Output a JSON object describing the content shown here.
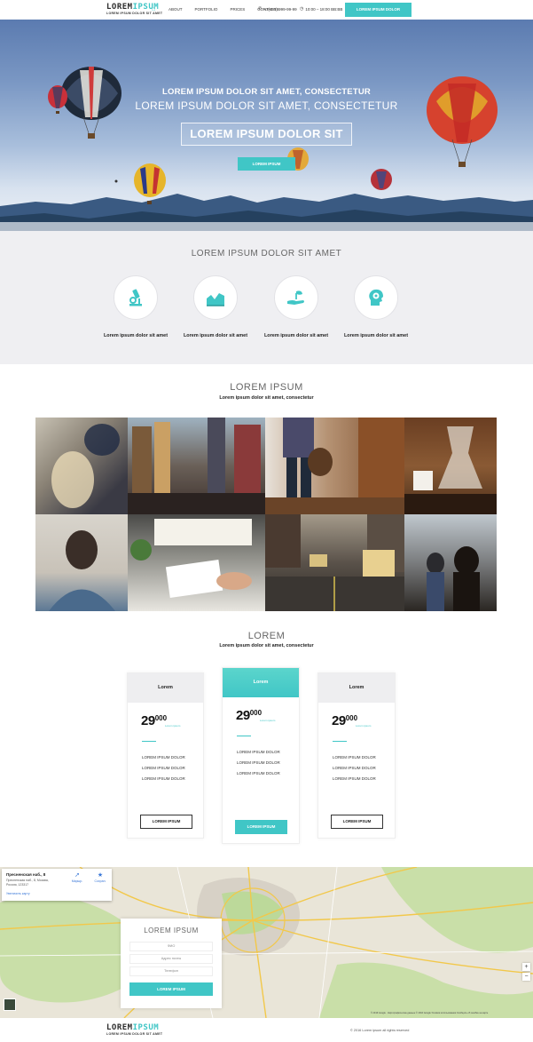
{
  "colors": {
    "accent": "#40c6c6",
    "dark": "#2b2b2b"
  },
  "header": {
    "logo_part1": "LOREM",
    "logo_part2": "IPSUM",
    "logo_sub": "LOREM IPSUM DOLOR SIT AMET",
    "nav": [
      "ABOUT",
      "PORTFOLIO",
      "PRICES",
      "CONTACTS"
    ],
    "phone": "+7(495) 999-99-99",
    "hours": "10:00 – 18:00 ВВ:ВВ",
    "button": "LOREM IPSUM DOLOR"
  },
  "hero": {
    "title1": "LOREM IPSUM DOLOR SIT AMET, CONSECTETUR",
    "title2": "LOREM IPSUM DOLOR SIT AMET, CONSECTETUR",
    "box_text": "LOREM IPSUM DOLOR SIT",
    "button": "LOREM IPSUM"
  },
  "features": {
    "title": "LOREM IPSUM DOLOR SIT AMET",
    "items": [
      {
        "icon": "microscope-icon",
        "label": "Lorem ipsum dolor sit amet"
      },
      {
        "icon": "chart-icon",
        "label": "Lorem ipsum dolor sit amet"
      },
      {
        "icon": "plant-hand-icon",
        "label": "Lorem ipsum dolor sit amet"
      },
      {
        "icon": "head-gear-icon",
        "label": "Lorem ipsum dolor sit amet"
      }
    ]
  },
  "gallery": {
    "title": "LOREM IPSUM",
    "subtitle": "Lorem ipsum dolor sit amet, consectetur"
  },
  "pricing": {
    "title": "LOREM",
    "subtitle": "Lorem ipsum dolor sit amet, consectetur",
    "cards": [
      {
        "name": "Lorem",
        "price": "29",
        "price_sup": "000",
        "note": "Lorem ipsum",
        "items": [
          "LOREM IPSUM DOLOR",
          "LOREM IPSUM DOLOR",
          "LOREM IPSUM DOLOR"
        ],
        "button": "LOREM IPSUM"
      },
      {
        "name": "Lorem",
        "price": "29",
        "price_sup": "000",
        "note": "Lorem ipsum",
        "items": [
          "LOREM IPSUM DOLOR",
          "LOREM IPSUM DOLOR",
          "LOREM IPSUM DOLOR"
        ],
        "button": "LOREM IPSUM"
      },
      {
        "name": "Lorem",
        "price": "29",
        "price_sup": "000",
        "note": "Lorem ipsum",
        "items": [
          "LOREM IPSUM DOLOR",
          "LOREM IPSUM DOLOR",
          "LOREM IPSUM DOLOR"
        ],
        "button": "LOREM IPSUM"
      }
    ]
  },
  "map": {
    "address": "Пресненская наб., 8",
    "address_detail": "Пресненская наб., 8, Москва, Россия, 123317",
    "link": "Увеличить карту",
    "route": "Маршр.",
    "save": "Сохран.",
    "copyright": "© 2016 Google · Картографические данные © 2016 Google   Условия использования   Сообщить об ошибке на карте"
  },
  "form": {
    "title": "LOREM IPSUM",
    "field1": "ФИО",
    "field2": "Адрес почты",
    "field3": "Телефон",
    "button": "LOREM IPSUM"
  },
  "footer": {
    "logo_part1": "LOREM",
    "logo_part2": "IPSUM",
    "logo_sub": "LOREM IPSUM DOLOR SIT AMET",
    "copyright": "© 2016 Lorem ipsum all rights reserved"
  }
}
